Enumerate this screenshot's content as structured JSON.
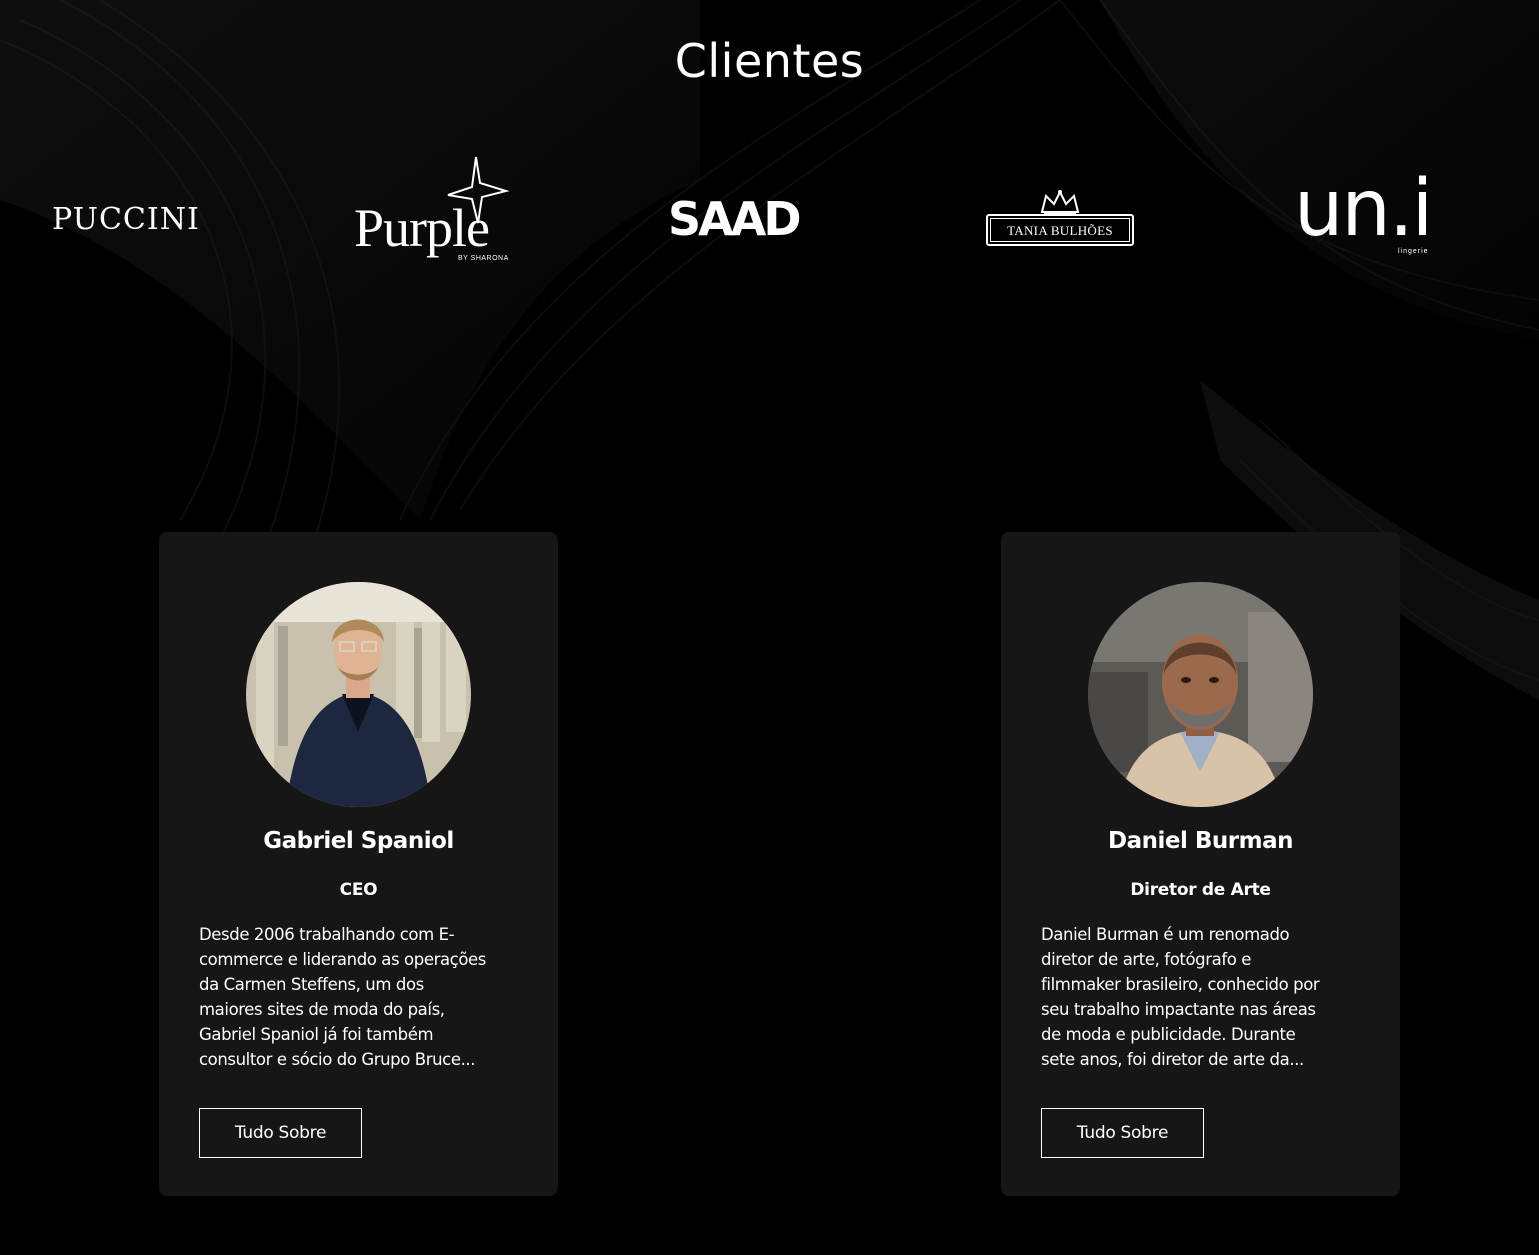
{
  "section": {
    "title": "Clientes"
  },
  "logos": [
    {
      "name": "PUCCINI",
      "text": "PUCCINI"
    },
    {
      "name": "Purple",
      "text": "Purple",
      "sub": "BY SHARONA"
    },
    {
      "name": "SAAD",
      "text": "SAAD"
    },
    {
      "name": "Tania Bulhoes",
      "text": "TANIA BULHÕES"
    },
    {
      "name": "un.i",
      "text": "un.i",
      "sub": "lingerie"
    }
  ],
  "team": [
    {
      "name": "Gabriel Spaniol",
      "role": "CEO",
      "description": "Desde 2006 trabalhando com E-\ncommerce e liderando as operações\nda Carmen Steffens, um dos\nmaiores sites de moda do país,\nGabriel Spaniol já foi também\nconsultor e sócio do Grupo Bruce...",
      "button": "Tudo Sobre"
    },
    {
      "name": "Daniel Burman",
      "role": "Diretor de Arte",
      "description": "Daniel Burman é um renomado\ndiretor de arte, fotógrafo e\nfilmmaker brasileiro, conhecido por\nseu trabalho impactante nas áreas\nde moda e publicidade. Durante\nsete anos, foi diretor de arte da...",
      "button": "Tudo Sobre"
    }
  ],
  "colors": {
    "background": "#000000",
    "card": "#161616",
    "text": "#ffffff"
  }
}
